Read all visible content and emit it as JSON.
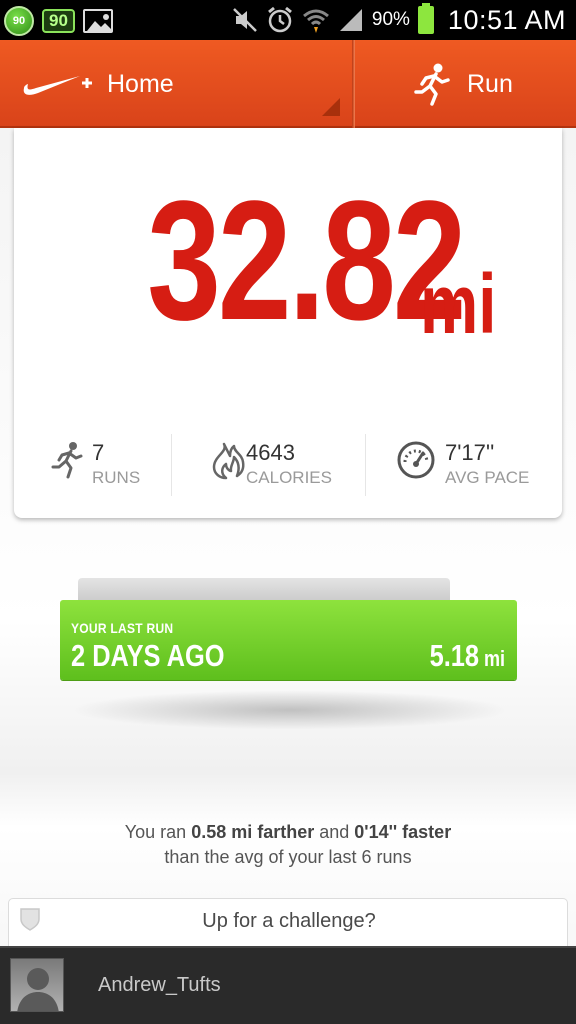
{
  "status_bar": {
    "notification_badge": "90",
    "battery_badge": "90",
    "battery_percent": "90%",
    "time": "10:51 AM",
    "icons": [
      "gallery-icon",
      "mute-icon",
      "alarm-icon",
      "wifi-icon",
      "signal-icon",
      "battery-icon"
    ]
  },
  "header": {
    "home_label": "Home",
    "run_label": "Run",
    "accent_color": "#e24e1d"
  },
  "summary": {
    "distance": "32.82",
    "distance_unit": "mi",
    "stats": [
      {
        "value": "7",
        "label": "RUNS",
        "icon": "runner-icon"
      },
      {
        "value": "4643",
        "label": "CALORIES",
        "icon": "flame-icon"
      },
      {
        "value": "7'17''",
        "label": "AVG PACE",
        "icon": "speedometer-icon"
      }
    ]
  },
  "last_run": {
    "label": "YOUR LAST RUN",
    "when": "2 DAYS AGO",
    "distance": "5.18",
    "unit": "mi",
    "color": "#7ad22e"
  },
  "comparison": {
    "prefix": "You ran ",
    "farther": "0.58 mi farther",
    "middle": " and ",
    "faster": "0'14'' faster",
    "suffix": "than the avg of your last 6 runs"
  },
  "challenge": {
    "label": "Up for a challenge?"
  },
  "user": {
    "name": "Andrew_Tufts"
  }
}
